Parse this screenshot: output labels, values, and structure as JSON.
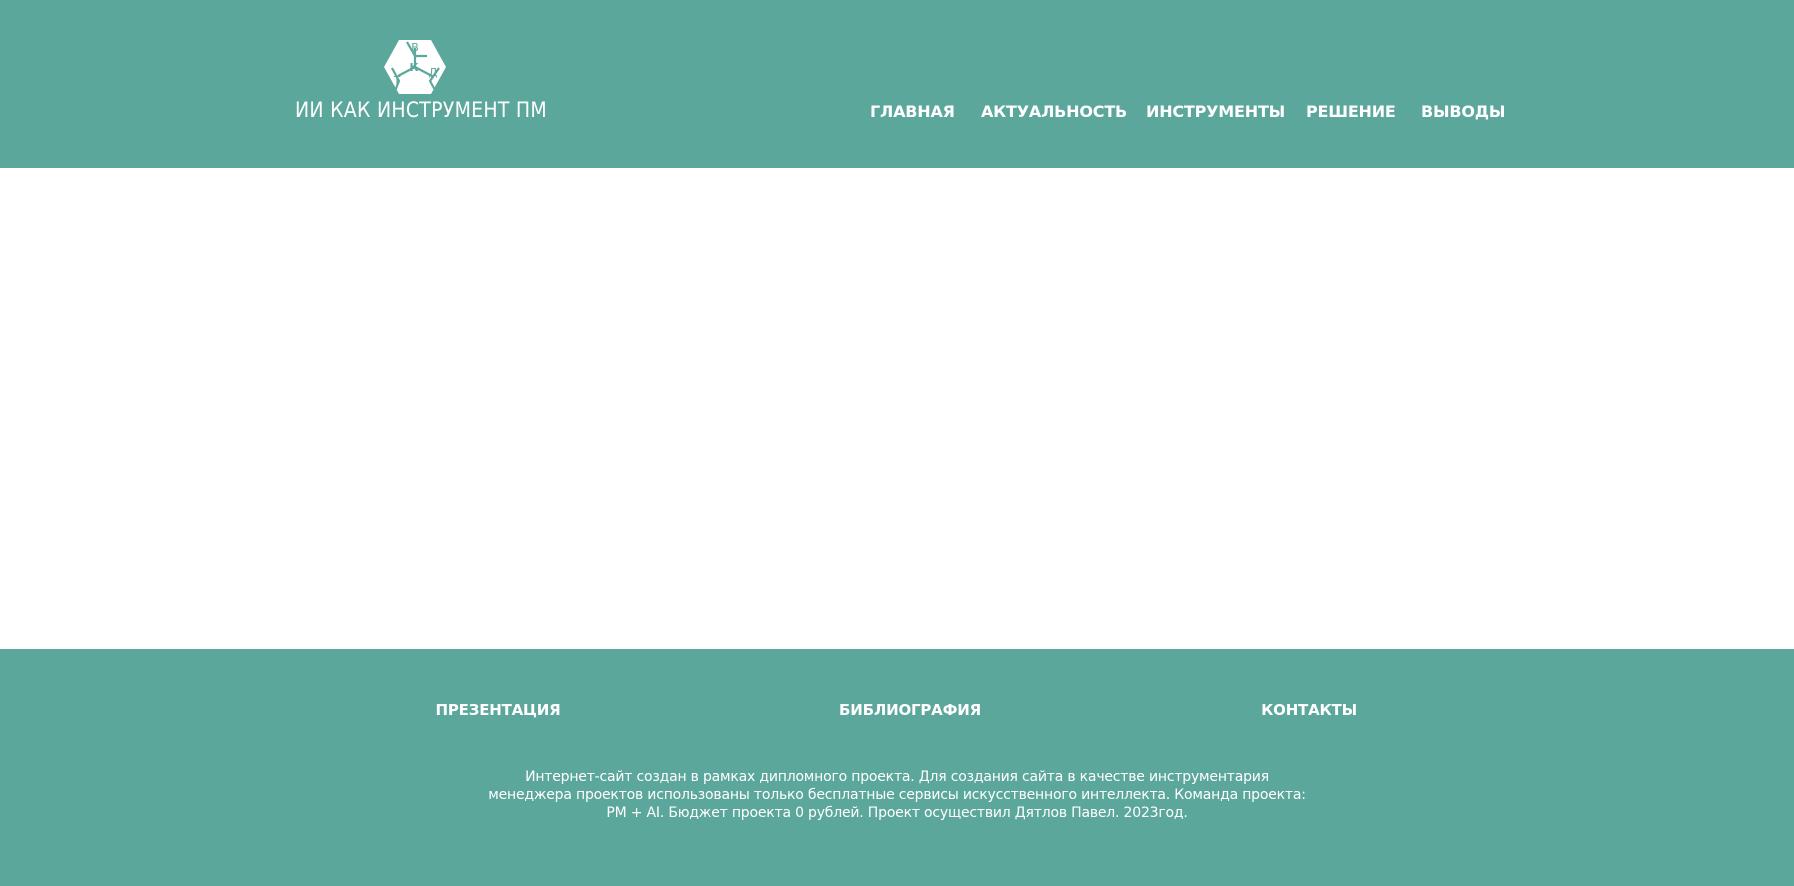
{
  "header": {
    "logo": {
      "letters": [
        "В",
        "К",
        "Д",
        "Т"
      ],
      "text": "ИИ КАК ИНСТРУМЕНТ ПМ",
      "icon": "hexagon-cube-logo-icon"
    },
    "nav": [
      {
        "label": "ГЛАВНАЯ"
      },
      {
        "label": "АКТУАЛЬНОСТЬ"
      },
      {
        "label": "ИНСТРУМЕНТЫ"
      },
      {
        "label": "РЕШЕНИЕ"
      },
      {
        "label": "ВЫВОДЫ"
      }
    ]
  },
  "footer": {
    "links": [
      {
        "label": "ПРЕЗЕНТАЦИЯ"
      },
      {
        "label": "БИБЛИОГРАФИЯ"
      },
      {
        "label": "КОНТАКТЫ"
      }
    ],
    "description": "Интернет-сайт создан в рамках дипломного проекта. Для создания сайта в качестве инструментария менеджера проектов использованы только бесплатные сервисы искусственного интеллекта. Команда проекта: PM + AI. Бюджет проекта 0 рублей. Проект осуществил Дятлов Павел. 2023год."
  },
  "colors": {
    "brand": "#5ba79c",
    "text_light": "#ffffff",
    "background": "#ffffff"
  }
}
